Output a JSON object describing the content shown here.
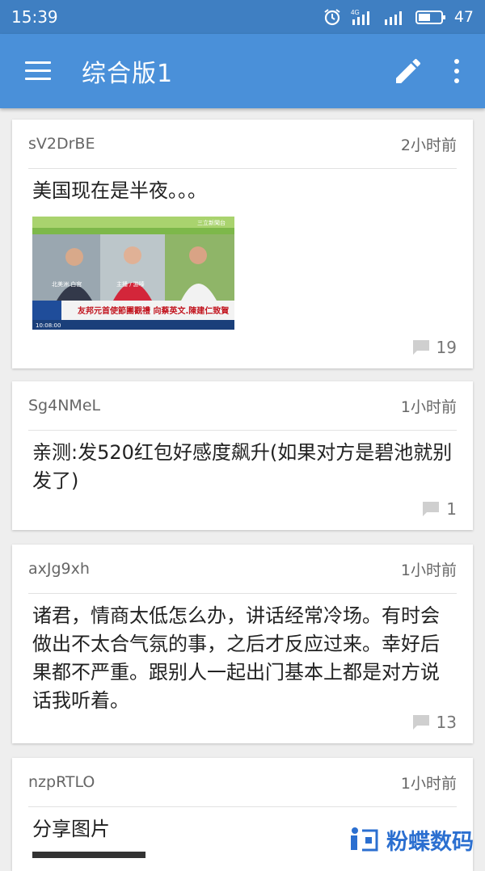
{
  "status": {
    "time": "15:39",
    "network": "4G",
    "battery": "47"
  },
  "appbar": {
    "title": "综合版1"
  },
  "posts": [
    {
      "user": "sV2DrBE",
      "time": "2小时前",
      "text": "美国现在是半夜。。。",
      "comments": "19",
      "image": {
        "ticker": "友邦元首使節團觀禮 向蔡英文.陳建仁致賀",
        "tag1": "北美洲.白宫",
        "tag2": "主播 / 游嗪",
        "logo": "三立新聞台",
        "clock": "10:08:00"
      }
    },
    {
      "user": "Sg4NMeL",
      "time": "1小时前",
      "text": "亲测:发520红包好感度飙升(如果对方是碧池就别发了)",
      "comments": "1"
    },
    {
      "user": "axJg9xh",
      "time": "1小时前",
      "text": "诸君，情商太低怎么办，讲话经常冷场。有时会做出不太合气氛的事，之后才反应过来。幸好后果都不严重。跟别人一起出门基本上都是对方说话我听着。",
      "comments": "13"
    },
    {
      "user": "nzpRTLO",
      "time": "1小时前",
      "text": "分享图片"
    }
  ],
  "watermark": {
    "text": "粉蝶数码"
  }
}
